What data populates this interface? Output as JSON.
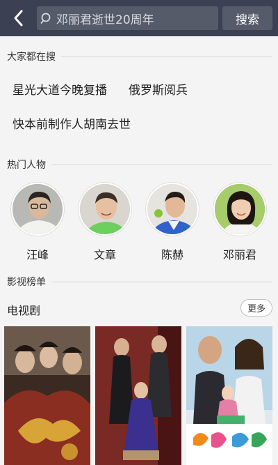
{
  "search": {
    "value": "邓丽君逝世20周年",
    "button_label": "搜索"
  },
  "sections": {
    "hot_search": "大家都在搜",
    "hot_people": "热门人物",
    "rankings": "影视榜单"
  },
  "hot_searches": [
    "星光大道今晚复播",
    "俄罗斯阅兵",
    "快本前制作人胡南去世"
  ],
  "people": [
    {
      "name": "汪峰"
    },
    {
      "name": "文章"
    },
    {
      "name": "陈赫"
    },
    {
      "name": "邓丽君"
    }
  ],
  "tv": {
    "title": "电视剧",
    "more_label": "更多"
  },
  "colors": {
    "topbar": "#3b4152",
    "search_field": "#565b6a",
    "background": "#f4f4f4"
  }
}
